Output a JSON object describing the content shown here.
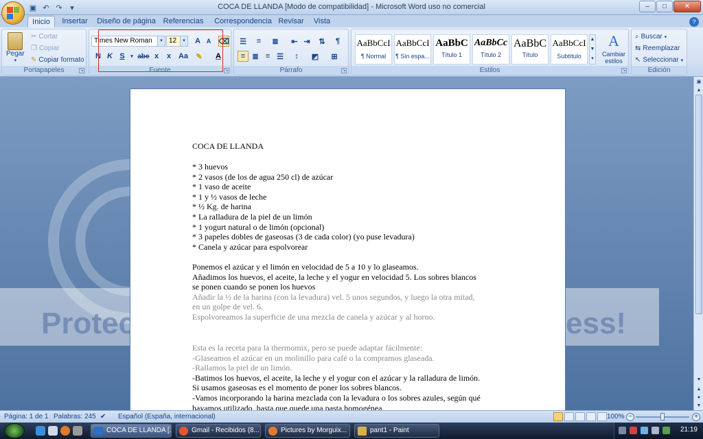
{
  "window": {
    "title": "COCA DE LLANDA [Modo de compatibilidad] - Microsoft Word uso no comercial"
  },
  "tabs": [
    "Inicio",
    "Insertar",
    "Diseño de página",
    "Referencias",
    "Correspondencia",
    "Revisar",
    "Vista"
  ],
  "ribbon": {
    "clipboard": {
      "paste_label": "Pegar",
      "cut_label": "Cortar",
      "copy_label": "Copiar",
      "format_painter_label": "Copiar formato",
      "group_label": "Portapapeles"
    },
    "font": {
      "font_name": "Times New Roman",
      "font_size": "12",
      "grow_label": "A",
      "shrink_label": "A",
      "bold_label": "N",
      "italic_label": "K",
      "underline_label": "S",
      "strike_label": "abe",
      "sub_label": "x",
      "sup_label": "x",
      "case_label": "Aa",
      "color_label": "A",
      "group_label": "Fuente"
    },
    "paragraph": {
      "group_label": "Párrafo"
    },
    "styles": {
      "items": [
        {
          "sample": "AaBbCcI",
          "name": "¶ Normal"
        },
        {
          "sample": "AaBbCcI",
          "name": "¶ Sin espa..."
        },
        {
          "sample": "AaBbC",
          "name": "Título 1"
        },
        {
          "sample": "AaBbCc",
          "name": "Título 2"
        },
        {
          "sample": "AaBbC",
          "name": "Título"
        },
        {
          "sample": "AaBbCcI",
          "name": "Subtítulo"
        }
      ],
      "change_styles_label": "Cambiar estilos",
      "group_label": "Estilos"
    },
    "editing": {
      "find_label": "Buscar",
      "replace_label": "Reemplazar",
      "select_label": "Seleccionar",
      "group_label": "Edición"
    }
  },
  "document": {
    "title": "COCA DE LLANDA",
    "ingredients": [
      "* 3 huevos",
      "* 2 vasos (de los de agua 250 cl) de azúcar",
      "* 1 vaso de aceite",
      "* 1 y ½ vasos de leche",
      "* ½ Kg. de harina",
      "* La ralladura de la piel de un limón",
      "* 1 yogurt natural o de limón (opcional)",
      "* 3 papeles dobles de gaseosas (3 de cada color) (yo puse levadura)",
      "* Canela y azúcar para espolvorear"
    ],
    "steps": [
      "Ponemos el azúcar y el limón en velocidad de 5 a 10 y lo glaseamos.",
      "Añadimos los huevos, el aceite, la leche y el yogur en velocidad 5. Los sobres blancos",
      "se ponen cuando se ponen los huevos",
      "Añadir la ½ de la harina (con la levadura) vel. 5 unos segundos, y luego la otra mitad,",
      "en un golpe de vel. 6.",
      "Espolvoreamos la superficie de una mezcla de canela y azúcar y al horno."
    ],
    "notes": [
      "Esta es la receta para la thermomix, pero se puede adaptar fácilmente:",
      "-Glaseamos el azúcar en un molinillo  para café o la compramos  glaseada.",
      "-Rallamos la piel de un limón.",
      "-Batimos los huevos, el aceite, la leche y el yogur con el azúcar y la ralladura de limón.",
      "Si usamos gaseosas es el momento de poner los sobres blancos.",
      "-Vamos incorporando la harina mezclada con la levadura o los sobres azules, según qué",
      "hayamos utilizado, hasta que quede una pasta homogénea."
    ]
  },
  "background_watermark": {
    "left_text": "Protec",
    "right_text": "ess!"
  },
  "statusbar": {
    "page": "Página: 1 de 1",
    "words": "Palabras: 245",
    "language": "Español (España, internacional)",
    "zoom": "100%"
  },
  "taskbar": {
    "tasks": [
      {
        "label": "COCA DE LLANDA [...",
        "active": true
      },
      {
        "label": "Gmail - Recibidos (8...",
        "active": false
      },
      {
        "label": "Pictures by Morguix...",
        "active": false
      },
      {
        "label": "pant1 - Paint",
        "active": false
      }
    ],
    "clock": "21:19"
  },
  "colors": {
    "accent": "#15428b",
    "highlight_box": "#d52b2b",
    "faded_text": "#8a8a8a"
  }
}
